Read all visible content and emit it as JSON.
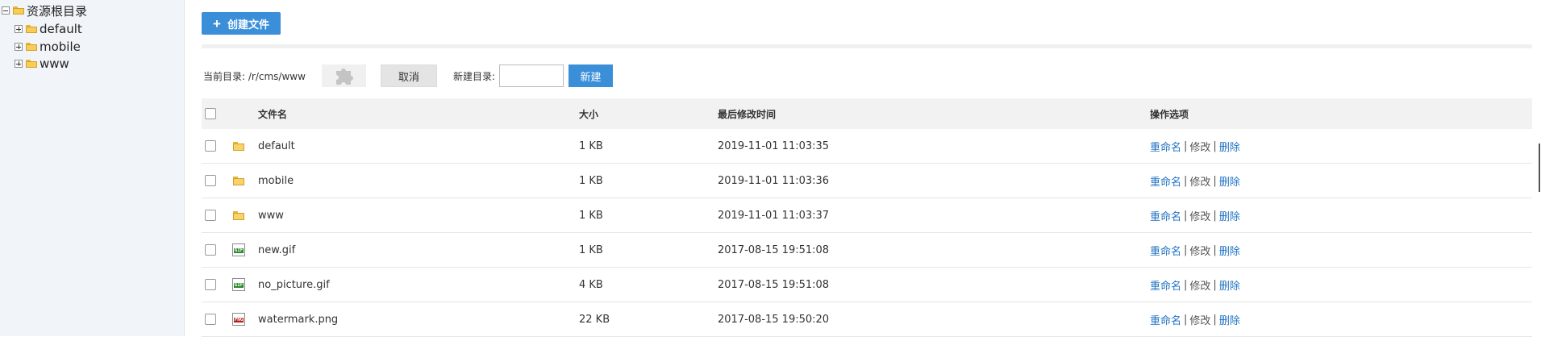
{
  "sidebar": {
    "root_label": "资源根目录",
    "items": [
      {
        "label": "default"
      },
      {
        "label": "mobile"
      },
      {
        "label": "www"
      }
    ]
  },
  "actions": {
    "create_file_label": "创建文件"
  },
  "toolbar": {
    "current_dir": "当前目录: /r/cms/www",
    "cancel_label": "取消",
    "new_dir_label": "新建目录:",
    "new_dir_value": "",
    "new_label": "新建"
  },
  "table": {
    "headers": {
      "name": "文件名",
      "size": "大小",
      "modified": "最后修改时间",
      "ops": "操作选项"
    },
    "ops": {
      "rename": "重命名",
      "edit": "修改",
      "delete": "删除",
      "sep": "|"
    },
    "rows": [
      {
        "icon": "folder-icon",
        "name": "default",
        "size": "1 KB",
        "modified": "2019-11-01 11:03:35"
      },
      {
        "icon": "folder-icon",
        "name": "mobile",
        "size": "1 KB",
        "modified": "2019-11-01 11:03:36"
      },
      {
        "icon": "folder-icon",
        "name": "www",
        "size": "1 KB",
        "modified": "2019-11-01 11:03:37"
      },
      {
        "icon": "gif-file-icon",
        "name": "new.gif",
        "size": "1 KB",
        "modified": "2017-08-15 19:51:08"
      },
      {
        "icon": "gif-file-icon",
        "name": "no_picture.gif",
        "size": "4 KB",
        "modified": "2017-08-15 19:51:08"
      },
      {
        "icon": "png-file-icon",
        "name": "watermark.png",
        "size": "22 KB",
        "modified": "2017-08-15 19:50:20"
      }
    ]
  },
  "colors": {
    "accent": "#3b8fd9",
    "link": "#1f72c3",
    "sidebar_bg": "#f1f5f9"
  }
}
